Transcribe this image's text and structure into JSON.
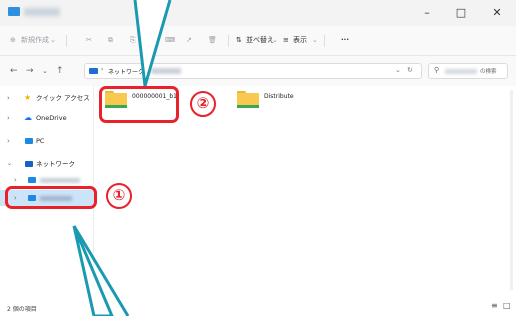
{
  "toolbar": {
    "new_label": "新規作成",
    "sort_label": "並べ替え",
    "view_label": "表示",
    "more_label": "···"
  },
  "address": {
    "segment": "ネットワーク"
  },
  "search": {
    "suffix": "の検索"
  },
  "sidebar": {
    "items": [
      {
        "label": "クイック アクセス"
      },
      {
        "label": "OneDrive"
      },
      {
        "label": "PC"
      },
      {
        "label": "ネットワーク"
      }
    ]
  },
  "files": [
    {
      "name": "000000001_b1"
    },
    {
      "name": "Distribute"
    }
  ],
  "status": {
    "count": "2 個の項目"
  },
  "annotations": {
    "one": "①",
    "two": "②"
  },
  "colors": {
    "annotation_red": "#e8212a",
    "folder_yellow": "#f8c94e"
  }
}
